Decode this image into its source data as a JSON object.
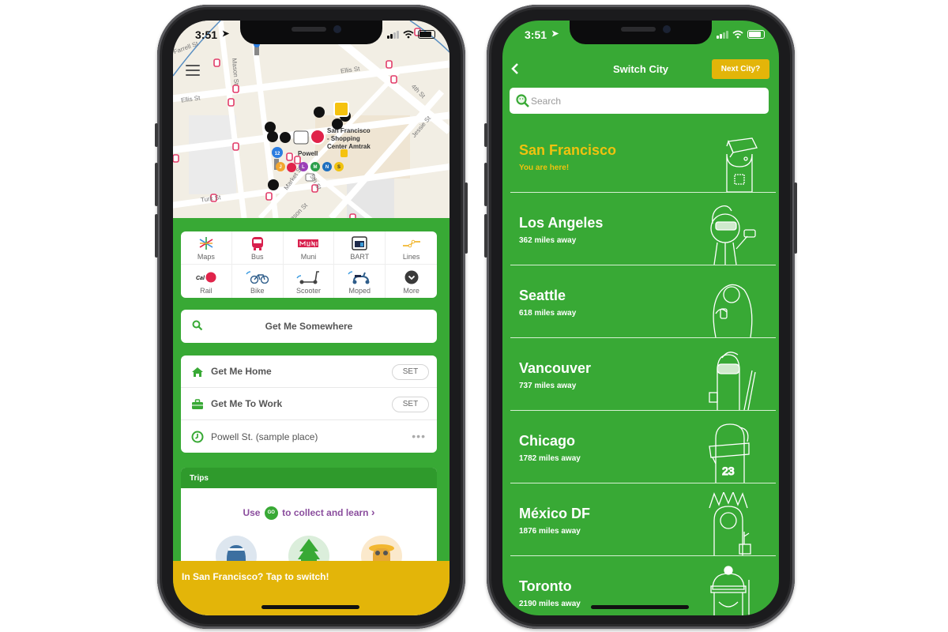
{
  "status_bar": {
    "time": "3:51"
  },
  "left_screen": {
    "map": {
      "streets": [
        "Farrell St",
        "Mason St",
        "Ellis St",
        "Ellis St",
        "4th St",
        "Jessie St",
        "Turk St",
        "5th St",
        "Market St",
        "Mason St"
      ],
      "places": [
        {
          "name": "San Francisco - Shopping Center Amtrak"
        },
        {
          "name": "Powell"
        }
      ],
      "transit_badges": [
        "12",
        "J",
        "L",
        "M",
        "N",
        "S"
      ],
      "menu_icon": "hamburger-icon"
    },
    "modes": [
      {
        "label": "Maps",
        "icon": "subway-map-icon"
      },
      {
        "label": "Bus",
        "icon": "bus-icon"
      },
      {
        "label": "Muni",
        "icon": "muni-icon"
      },
      {
        "label": "BART",
        "icon": "bart-icon"
      },
      {
        "label": "Lines",
        "icon": "lines-icon"
      },
      {
        "label": "Rail",
        "icon": "caltrain-icon"
      },
      {
        "label": "Bike",
        "icon": "bike-icon"
      },
      {
        "label": "Scooter",
        "icon": "scooter-icon"
      },
      {
        "label": "Moped",
        "icon": "moped-icon"
      },
      {
        "label": "More",
        "icon": "chevron-down-icon"
      }
    ],
    "get_me_somewhere": "Get Me Somewhere",
    "shortcuts": [
      {
        "label": "Get Me Home",
        "action": "SET",
        "icon": "home-icon"
      },
      {
        "label": "Get Me To Work",
        "action": "SET",
        "icon": "briefcase-icon"
      },
      {
        "label": "Powell St. (sample place)",
        "action": "•••",
        "icon": "clock-icon"
      }
    ],
    "trips": {
      "header": "Trips",
      "collect_prefix": "Use",
      "go_badge": "GO",
      "collect_suffix": "to collect and learn",
      "chevron": "›"
    },
    "switch_banner": "In San Francisco? Tap to switch!"
  },
  "right_screen": {
    "title": "Switch City",
    "next_city_button": "Next City?",
    "search_placeholder": "Search",
    "cities": [
      {
        "name": "San Francisco",
        "subtitle": "You are here!",
        "current": true
      },
      {
        "name": "Los Angeles",
        "subtitle": "362 miles away"
      },
      {
        "name": "Seattle",
        "subtitle": "618 miles away"
      },
      {
        "name": "Vancouver",
        "subtitle": "737 miles away"
      },
      {
        "name": "Chicago",
        "subtitle": "1782 miles away"
      },
      {
        "name": "México DF",
        "subtitle": "1876 miles away"
      },
      {
        "name": "Toronto",
        "subtitle": "2190 miles away"
      }
    ]
  },
  "colors": {
    "brand_green": "#38a935",
    "dark_green": "#2f9a2c",
    "yellow": "#e3b509",
    "current_city": "#f0c20f",
    "purple": "#8b4e9e"
  }
}
